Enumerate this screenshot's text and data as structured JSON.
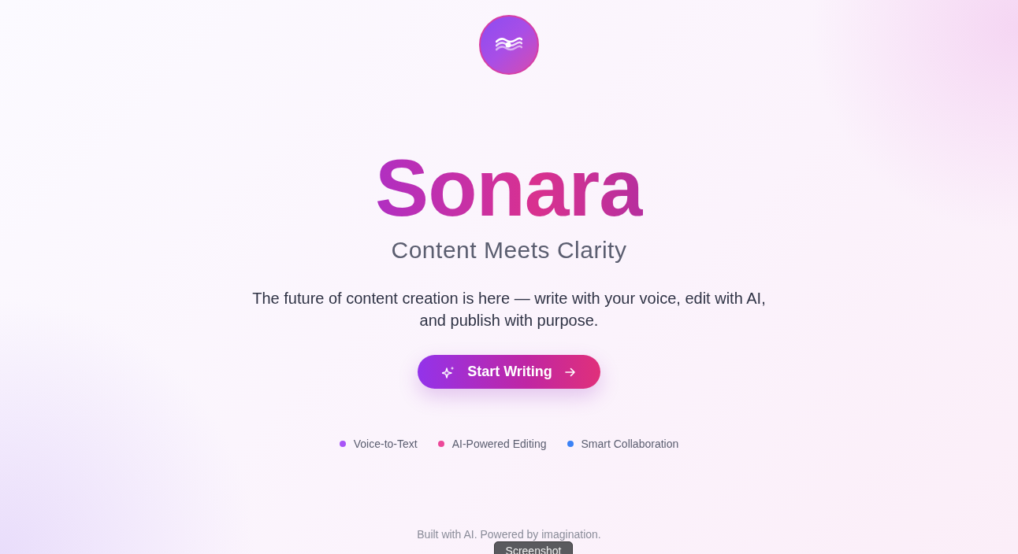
{
  "hero": {
    "title": "Sonara",
    "tagline": "Content Meets Clarity",
    "description": "The future of content creation is here — write with your voice, edit with AI, and publish with purpose."
  },
  "cta": {
    "label": "Start Writing"
  },
  "features": [
    {
      "label": "Voice-to-Text",
      "color": "#a855f7"
    },
    {
      "label": "AI-Powered Editing",
      "color": "#ec4899"
    },
    {
      "label": "Smart Collaboration",
      "color": "#3b82f6"
    }
  ],
  "footer": {
    "text": "Built with AI. Powered by imagination."
  },
  "tooltip": {
    "text": "Screenshot"
  }
}
